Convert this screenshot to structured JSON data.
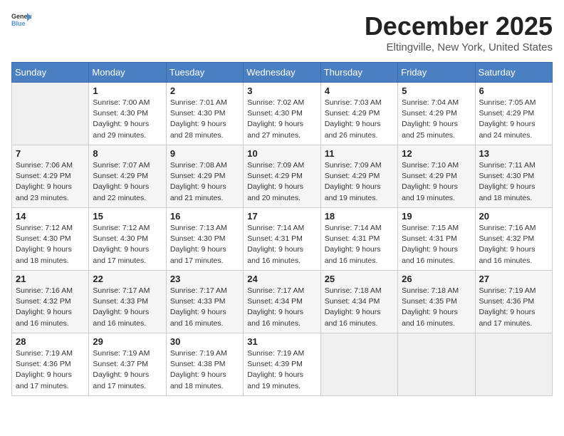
{
  "header": {
    "logo_general": "General",
    "logo_blue": "Blue",
    "month": "December 2025",
    "location": "Eltingville, New York, United States"
  },
  "days_of_week": [
    "Sunday",
    "Monday",
    "Tuesday",
    "Wednesday",
    "Thursday",
    "Friday",
    "Saturday"
  ],
  "weeks": [
    [
      {
        "day": "",
        "empty": true
      },
      {
        "day": "1",
        "sunrise": "7:00 AM",
        "sunset": "4:30 PM",
        "daylight": "9 hours and 29 minutes."
      },
      {
        "day": "2",
        "sunrise": "7:01 AM",
        "sunset": "4:30 PM",
        "daylight": "9 hours and 28 minutes."
      },
      {
        "day": "3",
        "sunrise": "7:02 AM",
        "sunset": "4:30 PM",
        "daylight": "9 hours and 27 minutes."
      },
      {
        "day": "4",
        "sunrise": "7:03 AM",
        "sunset": "4:29 PM",
        "daylight": "9 hours and 26 minutes."
      },
      {
        "day": "5",
        "sunrise": "7:04 AM",
        "sunset": "4:29 PM",
        "daylight": "9 hours and 25 minutes."
      },
      {
        "day": "6",
        "sunrise": "7:05 AM",
        "sunset": "4:29 PM",
        "daylight": "9 hours and 24 minutes."
      }
    ],
    [
      {
        "day": "7",
        "sunrise": "7:06 AM",
        "sunset": "4:29 PM",
        "daylight": "9 hours and 23 minutes."
      },
      {
        "day": "8",
        "sunrise": "7:07 AM",
        "sunset": "4:29 PM",
        "daylight": "9 hours and 22 minutes."
      },
      {
        "day": "9",
        "sunrise": "7:08 AM",
        "sunset": "4:29 PM",
        "daylight": "9 hours and 21 minutes."
      },
      {
        "day": "10",
        "sunrise": "7:09 AM",
        "sunset": "4:29 PM",
        "daylight": "9 hours and 20 minutes."
      },
      {
        "day": "11",
        "sunrise": "7:09 AM",
        "sunset": "4:29 PM",
        "daylight": "9 hours and 19 minutes."
      },
      {
        "day": "12",
        "sunrise": "7:10 AM",
        "sunset": "4:29 PM",
        "daylight": "9 hours and 19 minutes."
      },
      {
        "day": "13",
        "sunrise": "7:11 AM",
        "sunset": "4:30 PM",
        "daylight": "9 hours and 18 minutes."
      }
    ],
    [
      {
        "day": "14",
        "sunrise": "7:12 AM",
        "sunset": "4:30 PM",
        "daylight": "9 hours and 18 minutes."
      },
      {
        "day": "15",
        "sunrise": "7:12 AM",
        "sunset": "4:30 PM",
        "daylight": "9 hours and 17 minutes."
      },
      {
        "day": "16",
        "sunrise": "7:13 AM",
        "sunset": "4:30 PM",
        "daylight": "9 hours and 17 minutes."
      },
      {
        "day": "17",
        "sunrise": "7:14 AM",
        "sunset": "4:31 PM",
        "daylight": "9 hours and 16 minutes."
      },
      {
        "day": "18",
        "sunrise": "7:14 AM",
        "sunset": "4:31 PM",
        "daylight": "9 hours and 16 minutes."
      },
      {
        "day": "19",
        "sunrise": "7:15 AM",
        "sunset": "4:31 PM",
        "daylight": "9 hours and 16 minutes."
      },
      {
        "day": "20",
        "sunrise": "7:16 AM",
        "sunset": "4:32 PM",
        "daylight": "9 hours and 16 minutes."
      }
    ],
    [
      {
        "day": "21",
        "sunrise": "7:16 AM",
        "sunset": "4:32 PM",
        "daylight": "9 hours and 16 minutes."
      },
      {
        "day": "22",
        "sunrise": "7:17 AM",
        "sunset": "4:33 PM",
        "daylight": "9 hours and 16 minutes."
      },
      {
        "day": "23",
        "sunrise": "7:17 AM",
        "sunset": "4:33 PM",
        "daylight": "9 hours and 16 minutes."
      },
      {
        "day": "24",
        "sunrise": "7:17 AM",
        "sunset": "4:34 PM",
        "daylight": "9 hours and 16 minutes."
      },
      {
        "day": "25",
        "sunrise": "7:18 AM",
        "sunset": "4:34 PM",
        "daylight": "9 hours and 16 minutes."
      },
      {
        "day": "26",
        "sunrise": "7:18 AM",
        "sunset": "4:35 PM",
        "daylight": "9 hours and 16 minutes."
      },
      {
        "day": "27",
        "sunrise": "7:19 AM",
        "sunset": "4:36 PM",
        "daylight": "9 hours and 17 minutes."
      }
    ],
    [
      {
        "day": "28",
        "sunrise": "7:19 AM",
        "sunset": "4:36 PM",
        "daylight": "9 hours and 17 minutes."
      },
      {
        "day": "29",
        "sunrise": "7:19 AM",
        "sunset": "4:37 PM",
        "daylight": "9 hours and 17 minutes."
      },
      {
        "day": "30",
        "sunrise": "7:19 AM",
        "sunset": "4:38 PM",
        "daylight": "9 hours and 18 minutes."
      },
      {
        "day": "31",
        "sunrise": "7:19 AM",
        "sunset": "4:39 PM",
        "daylight": "9 hours and 19 minutes."
      },
      {
        "day": "",
        "empty": true
      },
      {
        "day": "",
        "empty": true
      },
      {
        "day": "",
        "empty": true
      }
    ]
  ],
  "labels": {
    "sunrise": "Sunrise:",
    "sunset": "Sunset:",
    "daylight": "Daylight:"
  }
}
